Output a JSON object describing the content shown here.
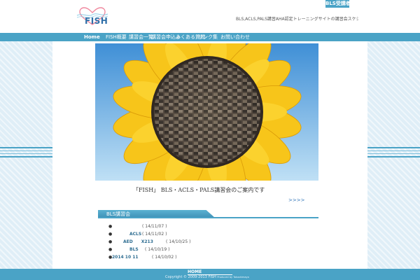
{
  "header": {
    "top_link": "BLS受講者",
    "logo_text": "FISH",
    "tagline": "BLS,ACLS,PALS講習AHA認定トレーニングサイトの講習会スケジュールです"
  },
  "nav": [
    {
      "label": "Home"
    },
    {
      "label": "FISH概要"
    },
    {
      "label": "講習会一覧"
    },
    {
      "label": "講習会申込み"
    },
    {
      "label": "よくある質問"
    },
    {
      "label": "リンク集"
    },
    {
      "label": "お問い合わせ"
    }
  ],
  "main": {
    "headline": "「FISH」 BLS・ACLS・PALS講習会のご案内です",
    "more_link": ">>>>"
  },
  "news": {
    "title": "BLS講習会",
    "items": [
      {
        "label": "",
        "date": "( 14/11/07 )"
      },
      {
        "label": "ACLS",
        "date": "( 14/11/02 )"
      },
      {
        "label": "AED　　X213",
        "date": "( 14/10/25 )"
      },
      {
        "label": "BLS",
        "date": "( 14/10/19 )"
      },
      {
        "label": "2014 10 11",
        "date": "( 14/10/02 )"
      }
    ]
  },
  "footer": {
    "home_link": "HOME",
    "copyright": "Copyright © 2009-2013 FISH",
    "powered": "Produced by Tokushimaya"
  },
  "colors": {
    "brand": "#4aa3c6",
    "background": "#dfeef7",
    "link": "#2f74b8"
  }
}
